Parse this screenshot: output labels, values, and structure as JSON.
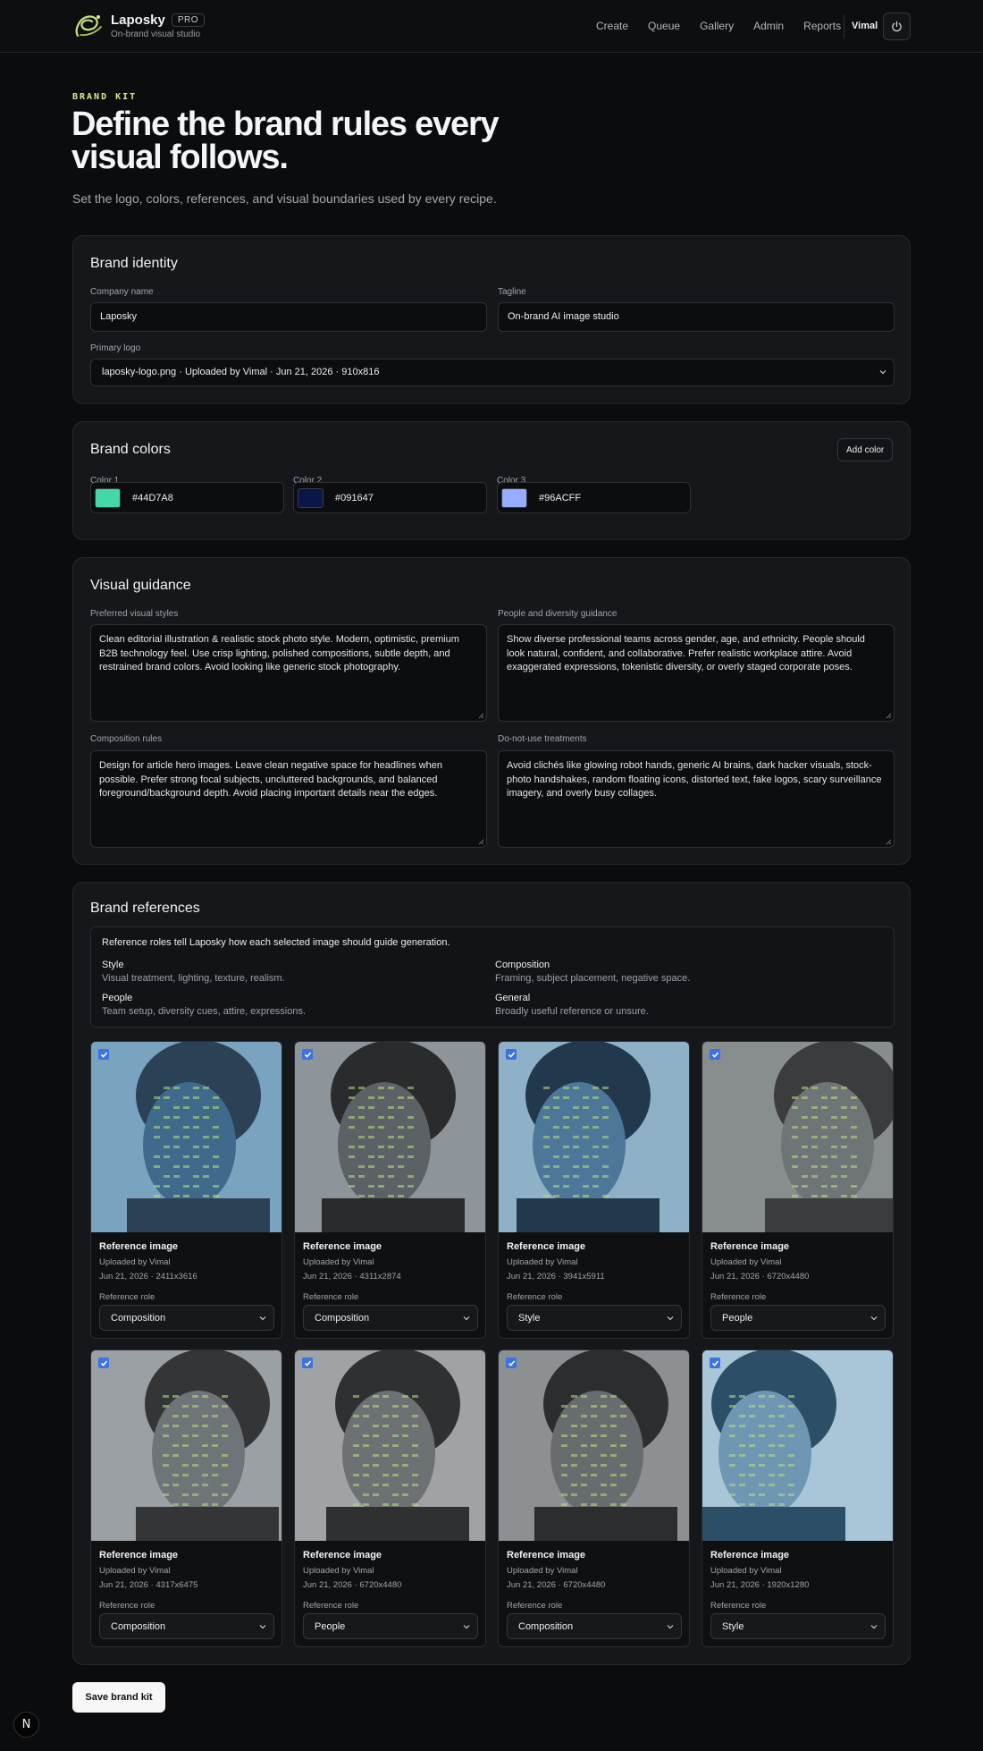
{
  "header": {
    "brand_name": "Laposky",
    "badge": "PRO",
    "subtitle": "On-brand visual studio",
    "nav": [
      "Create",
      "Queue",
      "Gallery",
      "Admin",
      "Reports"
    ],
    "user": "Vimal"
  },
  "hero": {
    "eyebrow": "BRAND KIT",
    "title": "Define the brand rules every visual follows.",
    "subtitle": "Set the logo, colors, references, and visual boundaries used by every recipe."
  },
  "identity": {
    "title": "Brand identity",
    "company_label": "Company name",
    "company_value": "Laposky",
    "tagline_label": "Tagline",
    "tagline_value": "On-brand AI image studio",
    "logo_label": "Primary logo",
    "logo_value": "laposky-logo.png · Uploaded by Vimal · Jun 21, 2026 · 910x816"
  },
  "colors": {
    "title": "Brand colors",
    "add_label": "Add color",
    "items": [
      {
        "label": "Color 1",
        "hex": "#44D7A8"
      },
      {
        "label": "Color 2",
        "hex": "#091647"
      },
      {
        "label": "Color 3",
        "hex": "#96ACFF"
      }
    ]
  },
  "guidance": {
    "title": "Visual guidance",
    "styles_label": "Preferred visual styles",
    "styles_value": "Clean editorial illustration & realistic stock photo style. Modern, optimistic, premium B2B technology feel. Use crisp lighting, polished compositions, subtle depth, and restrained brand colors. Avoid looking like generic stock photography.",
    "people_label": "People and diversity guidance",
    "people_value": "Show diverse professional teams across gender, age, and ethnicity. People should look natural, confident, and collaborative. Prefer realistic workplace attire. Avoid exaggerated expressions, tokenistic diversity, or overly staged corporate poses.",
    "composition_label": "Composition rules",
    "composition_value": "Design for article hero images. Leave clean negative space for headlines when possible. Prefer strong focal subjects, uncluttered backgrounds, and balanced foreground/background depth. Avoid placing important details near the edges.",
    "dont_label": "Do-not-use treatments",
    "dont_value": "Avoid clichés like glowing robot hands, generic AI brains, dark hacker visuals, stock-photo handshakes, random floating icons, distorted text, fake logos, scary surveillance imagery, and overly busy collages."
  },
  "references": {
    "title": "Brand references",
    "intro": "Reference roles tell Laposky how each selected image should guide generation.",
    "roles": [
      {
        "name": "Style",
        "desc": "Visual treatment, lighting, texture, realism."
      },
      {
        "name": "Composition",
        "desc": "Framing, subject placement, negative space."
      },
      {
        "name": "People",
        "desc": "Team setup, diversity cues, attire, expressions."
      },
      {
        "name": "General",
        "desc": "Broadly useful reference or unsure."
      }
    ],
    "items": [
      {
        "title": "Reference image",
        "uploader": "Uploaded by Vimal",
        "meta": "Jun 21, 2026 · 2411x3616",
        "role_label": "Reference role",
        "role": "Composition"
      },
      {
        "title": "Reference image",
        "uploader": "Uploaded by Vimal",
        "meta": "Jun 21, 2026 · 4311x2874",
        "role_label": "Reference role",
        "role": "Composition"
      },
      {
        "title": "Reference image",
        "uploader": "Uploaded by Vimal",
        "meta": "Jun 21, 2026 · 3941x5911",
        "role_label": "Reference role",
        "role": "Style"
      },
      {
        "title": "Reference image",
        "uploader": "Uploaded by Vimal",
        "meta": "Jun 21, 2026 · 6720x4480",
        "role_label": "Reference role",
        "role": "People"
      },
      {
        "title": "Reference image",
        "uploader": "Uploaded by Vimal",
        "meta": "Jun 21, 2026 · 4317x6475",
        "role_label": "Reference role",
        "role": "Composition"
      },
      {
        "title": "Reference image",
        "uploader": "Uploaded by Vimal",
        "meta": "Jun 21, 2026 · 6720x4480",
        "role_label": "Reference role",
        "role": "People"
      },
      {
        "title": "Reference image",
        "uploader": "Uploaded by Vimal",
        "meta": "Jun 21, 2026 · 6720x4480",
        "role_label": "Reference role",
        "role": "Composition"
      },
      {
        "title": "Reference image",
        "uploader": "Uploaded by Vimal",
        "meta": "Jun 21, 2026 · 1920x1280",
        "role_label": "Reference role",
        "role": "Style"
      }
    ]
  },
  "save_label": "Save brand kit",
  "dev_badge": "N",
  "theme": {
    "accent": "#d8ee8a",
    "check": "#3b73e6",
    "bg": "#0b0c0e",
    "card": "#16171a"
  }
}
